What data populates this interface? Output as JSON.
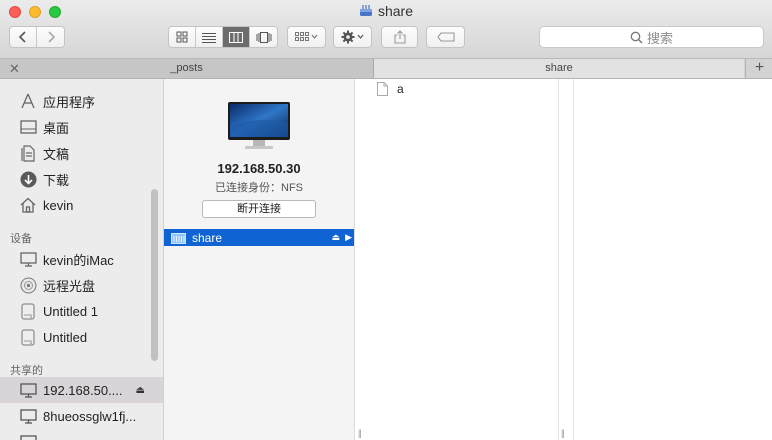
{
  "window": {
    "title": "share",
    "title_icon": "network-share-disk-icon"
  },
  "toolbar": {
    "back_icon": "chevron-left-icon",
    "forward_icon": "chevron-right-icon",
    "views": [
      "icon-view-icon",
      "list-view-icon",
      "column-view-icon",
      "cover-flow-icon"
    ],
    "active_view": "column-view-icon",
    "search_placeholder": "搜索"
  },
  "tabs": [
    {
      "label": "_posts",
      "active": false
    },
    {
      "label": "share",
      "active": true
    }
  ],
  "sidebar": {
    "favorites": [
      {
        "label": "应用程序",
        "icon": "applications-icon"
      },
      {
        "label": "桌面",
        "icon": "desktop-icon"
      },
      {
        "label": "文稿",
        "icon": "documents-icon"
      },
      {
        "label": "下载",
        "icon": "downloads-icon"
      },
      {
        "label": "kevin",
        "icon": "home-icon"
      }
    ],
    "devices_header": "设备",
    "devices": [
      {
        "label": "kevin的iMac",
        "icon": "imac-icon"
      },
      {
        "label": "远程光盘",
        "icon": "remote-disc-icon"
      },
      {
        "label": "Untitled 1",
        "icon": "external-drive-icon"
      },
      {
        "label": "Untitled",
        "icon": "external-drive-icon"
      }
    ],
    "shared_header": "共享的",
    "shared": [
      {
        "label": "192.168.50....",
        "icon": "network-computer-icon",
        "selected": true
      },
      {
        "label": "8hueossglw1fj...",
        "icon": "network-computer-icon",
        "selected": false
      }
    ]
  },
  "server": {
    "host": "192.168.50.30",
    "status": "已连接身份：NFS",
    "disconnect_label": "断开连接",
    "share_label": "share"
  },
  "files": [
    {
      "name": "a",
      "icon": "document-icon"
    }
  ],
  "colors": {
    "selection": "#0f63d2",
    "sidebar_bg": "#ececec"
  }
}
